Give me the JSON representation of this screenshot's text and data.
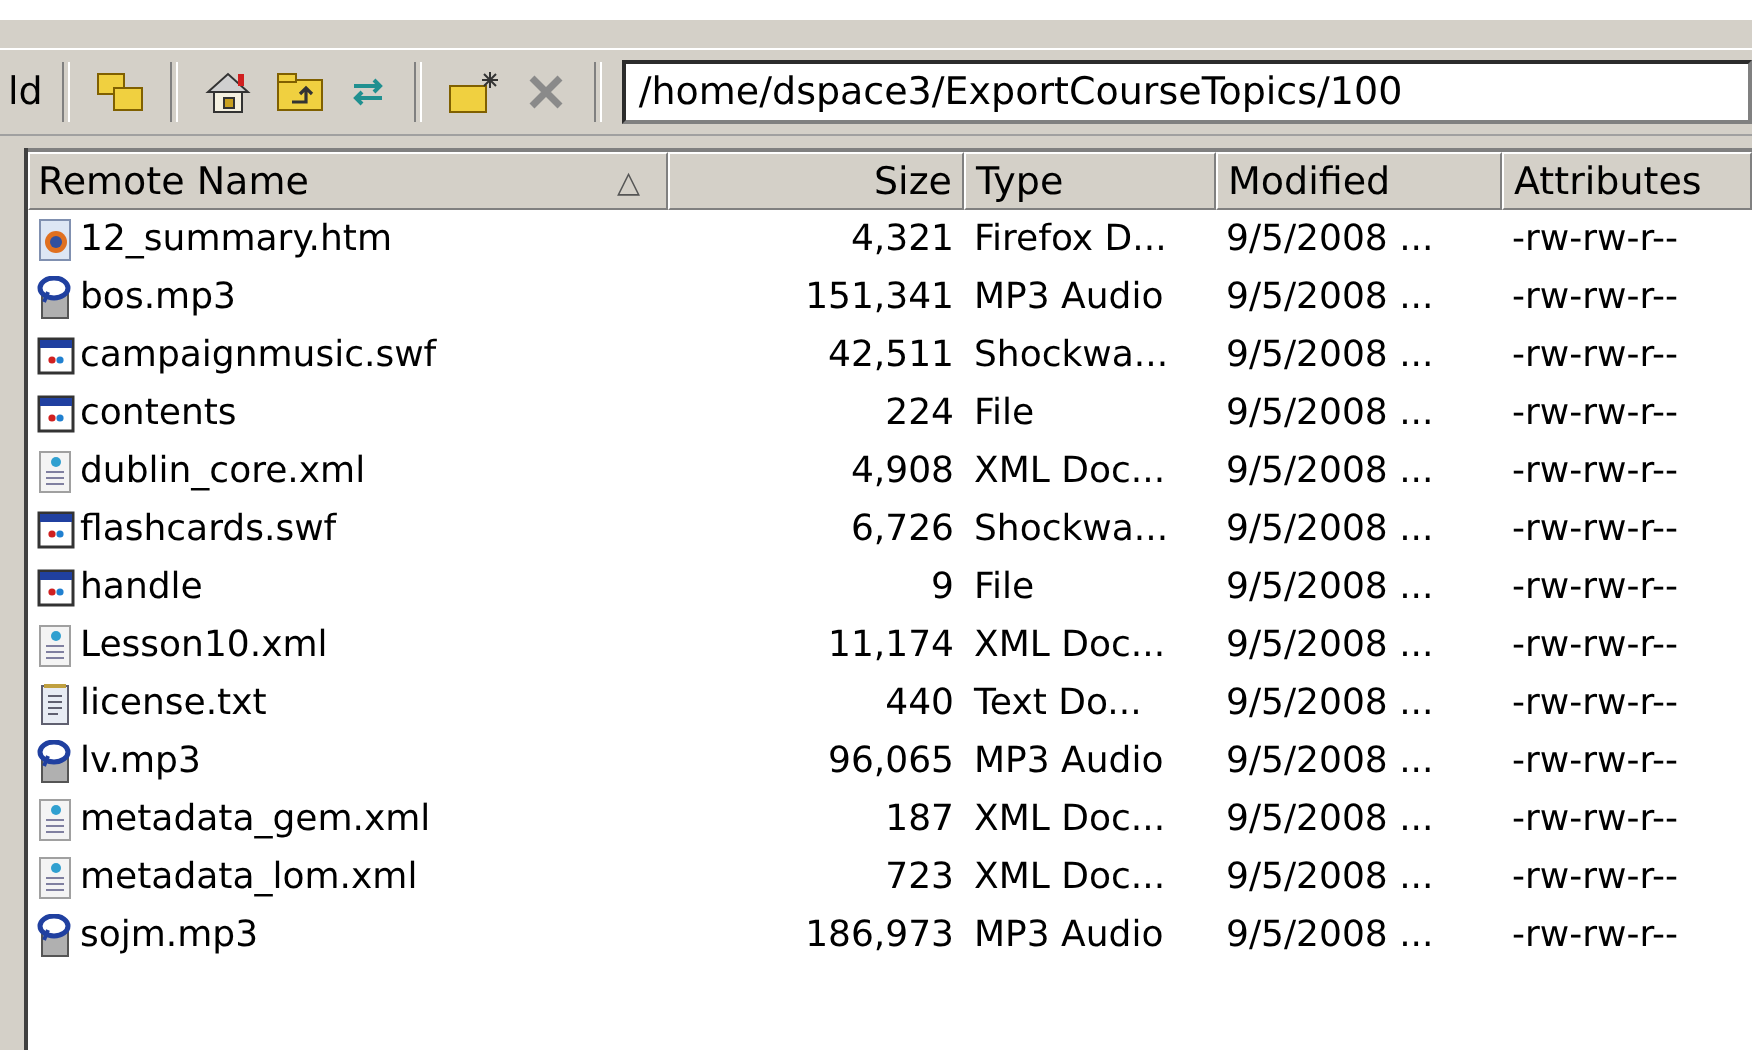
{
  "toolbar": {
    "cut_label": "ld",
    "path": "/home/dspace3/ExportCourseTopics/100"
  },
  "table": {
    "columns": [
      {
        "label": "Remote Name",
        "sorted": true
      },
      {
        "label": "Size",
        "sorted": false
      },
      {
        "label": "Type",
        "sorted": false
      },
      {
        "label": "Modified",
        "sorted": false
      },
      {
        "label": "Attributes",
        "sorted": false
      }
    ],
    "sort_glyph": "△",
    "rows": [
      {
        "kind": "html",
        "name": "12_summary.htm",
        "size": "4,321",
        "type": "Firefox D...",
        "modified": "9/5/2008 ...",
        "attributes": "-rw-rw-r--"
      },
      {
        "kind": "audio",
        "name": "bos.mp3",
        "size": "151,341",
        "type": "MP3 Audio",
        "modified": "9/5/2008 ...",
        "attributes": "-rw-rw-r--"
      },
      {
        "kind": "swf",
        "name": "campaignmusic.swf",
        "size": "42,511",
        "type": "Shockwa...",
        "modified": "9/5/2008 ...",
        "attributes": "-rw-rw-r--"
      },
      {
        "kind": "swf",
        "name": "contents",
        "size": "224",
        "type": "File",
        "modified": "9/5/2008 ...",
        "attributes": "-rw-rw-r--"
      },
      {
        "kind": "xml",
        "name": "dublin_core.xml",
        "size": "4,908",
        "type": "XML Doc...",
        "modified": "9/5/2008 ...",
        "attributes": "-rw-rw-r--"
      },
      {
        "kind": "swf",
        "name": "flashcards.swf",
        "size": "6,726",
        "type": "Shockwa...",
        "modified": "9/5/2008 ...",
        "attributes": "-rw-rw-r--"
      },
      {
        "kind": "swf",
        "name": "handle",
        "size": "9",
        "type": "File",
        "modified": "9/5/2008 ...",
        "attributes": "-rw-rw-r--"
      },
      {
        "kind": "xml",
        "name": "Lesson10.xml",
        "size": "11,174",
        "type": "XML Doc...",
        "modified": "9/5/2008 ...",
        "attributes": "-rw-rw-r--"
      },
      {
        "kind": "txt",
        "name": "license.txt",
        "size": "440",
        "type": "Text Do...",
        "modified": "9/5/2008 ...",
        "attributes": "-rw-rw-r--"
      },
      {
        "kind": "audio",
        "name": "lv.mp3",
        "size": "96,065",
        "type": "MP3 Audio",
        "modified": "9/5/2008 ...",
        "attributes": "-rw-rw-r--"
      },
      {
        "kind": "xml",
        "name": "metadata_gem.xml",
        "size": "187",
        "type": "XML Doc...",
        "modified": "9/5/2008 ...",
        "attributes": "-rw-rw-r--"
      },
      {
        "kind": "xml",
        "name": "metadata_lom.xml",
        "size": "723",
        "type": "XML Doc...",
        "modified": "9/5/2008 ...",
        "attributes": "-rw-rw-r--"
      },
      {
        "kind": "audio",
        "name": "sojm.mp3",
        "size": "186,973",
        "type": "MP3 Audio",
        "modified": "9/5/2008 ...",
        "attributes": "-rw-rw-r--"
      }
    ]
  }
}
